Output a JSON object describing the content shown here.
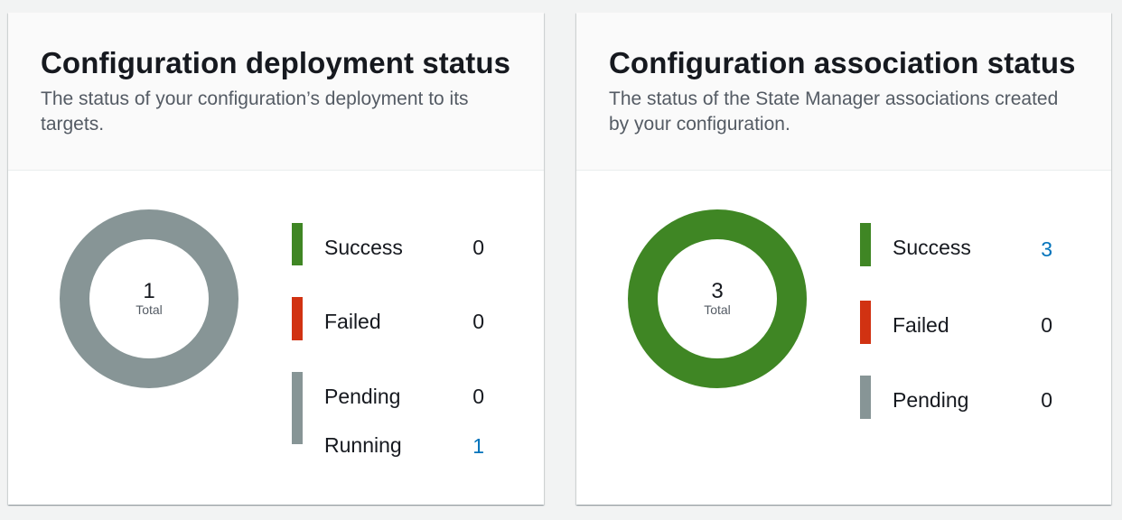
{
  "colors": {
    "success": "#3f8624",
    "failed": "#d13212",
    "pending": "#879596",
    "link": "#0073bb"
  },
  "deployment": {
    "title": "Configuration deployment status",
    "description": "The status of your configuration’s deployment to its targets.",
    "total_value": "1",
    "total_label": "Total",
    "donut_color": "pending",
    "items": [
      {
        "label": "Success",
        "value": "0",
        "color": "success"
      },
      {
        "label": "Failed",
        "value": "0",
        "color": "failed"
      },
      {
        "label": "Pending",
        "value": "0",
        "color": "pending"
      },
      {
        "label": "Running",
        "value": "1",
        "color": "pending"
      }
    ]
  },
  "association": {
    "title": "Configuration association status",
    "description": "The status of the State Manager associations created by your configuration.",
    "total_value": "3",
    "total_label": "Total",
    "donut_color": "success",
    "items": [
      {
        "label": "Success",
        "value": "3",
        "color": "success"
      },
      {
        "label": "Failed",
        "value": "0",
        "color": "failed"
      },
      {
        "label": "Pending",
        "value": "0",
        "color": "pending"
      }
    ]
  }
}
